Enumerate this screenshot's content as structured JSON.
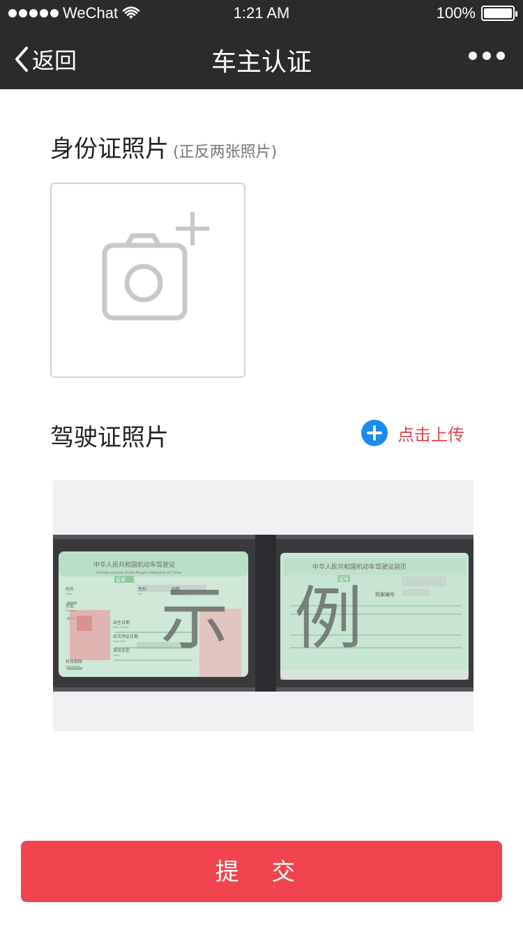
{
  "status_bar": {
    "carrier": "WeChat",
    "time": "1:21 AM",
    "battery": "100%",
    "battery_level": 1.0,
    "icons": [
      "signal-dots-icon",
      "wifi-icon",
      "battery-icon"
    ]
  },
  "nav": {
    "back_label": "返回",
    "title": "车主认证",
    "icons": [
      "chevron-left-icon",
      "more-icon"
    ]
  },
  "id_section": {
    "title": "身份证照片",
    "subtitle": "(正反两张照片)",
    "icon": "camera-plus-icon"
  },
  "license_section": {
    "title": "驾驶证照片",
    "upload_label": "点击上传",
    "icon": "plus-circle-icon",
    "sample": {
      "watermark_left": "示",
      "watermark_right": "例",
      "left_card_header": "中华人民共和国机动车驾驶证",
      "left_card_header_en": "Driving License of the People's Republic of China",
      "left_card_tag": "证号",
      "left_card_fields": [
        "姓名",
        "性别",
        "国籍",
        "住址",
        "出生日期",
        "初次领证日期",
        "准驾车型",
        "有效期限"
      ],
      "left_card_fields_en": [
        "Name",
        "Sex",
        "Nationality",
        "Address",
        "Date of Birth",
        "Issue Date",
        "Class",
        "Valid Period"
      ],
      "right_card_header": "中华人民共和国机动车驾驶证副页",
      "right_card_tag": "证号",
      "right_card_file_label": "档案编号"
    }
  },
  "submit": {
    "label": "提 交"
  },
  "colors": {
    "nav_bg": "#2b2b2e",
    "accent_red": "#f1444f",
    "link_red": "#e8434c",
    "plus_blue": "#1a8cf0",
    "box_border": "#d4d4d8"
  }
}
